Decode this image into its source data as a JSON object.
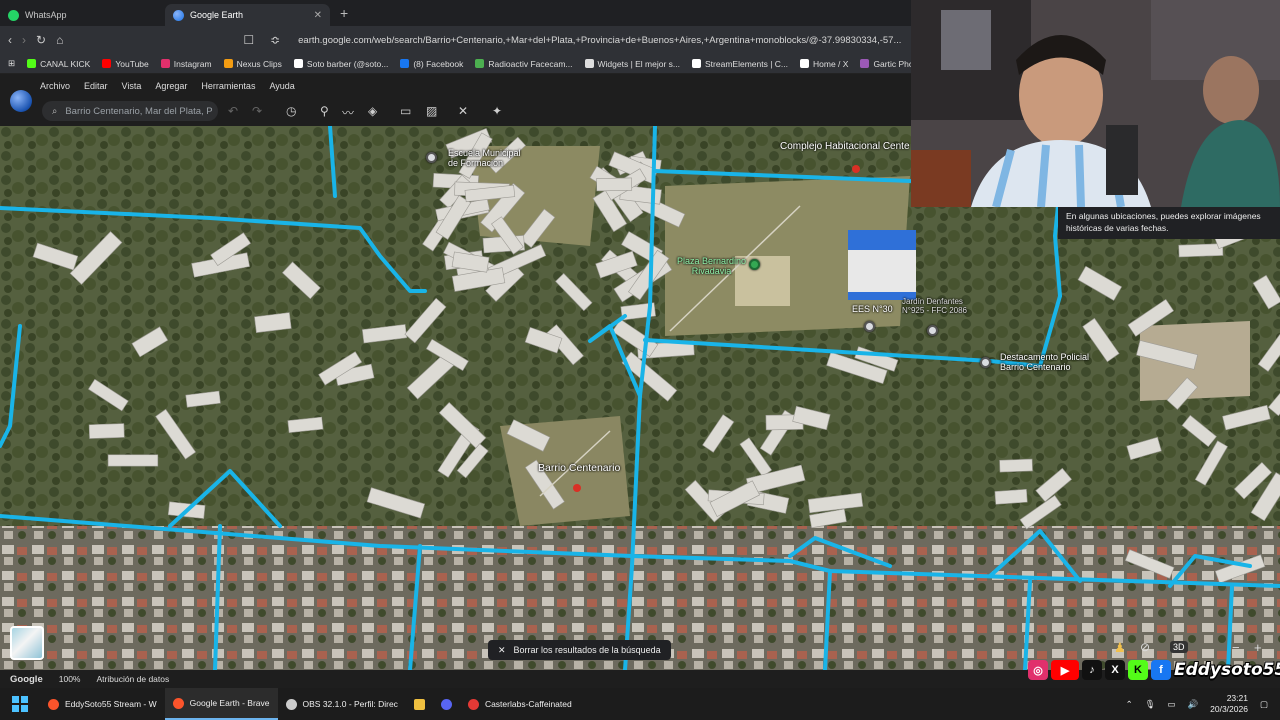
{
  "browser": {
    "tabs": [
      {
        "title": "WhatsApp",
        "active": false,
        "icon": "whatsapp-icon",
        "color": "#25d366"
      },
      {
        "title": "Google Earth",
        "active": true,
        "icon": "google-earth-icon",
        "color": "#4285f4"
      }
    ],
    "new_tab": "+",
    "url": "earth.google.com/web/search/Barrio+Centenario,+Mar+del+Plata,+Provincia+de+Buenos+Aires,+Argentina+monoblocks/@-37.99830334,-57...",
    "bookmarks": [
      {
        "label": "CANAL KICK",
        "color": "#53fc18"
      },
      {
        "label": "YouTube",
        "color": "#ff0000"
      },
      {
        "label": "Instagram",
        "color": "#e1306c"
      },
      {
        "label": "Nexus Clips",
        "color": "#f39c12"
      },
      {
        "label": "Soto barber (@soto...",
        "color": "#ffffff"
      },
      {
        "label": "(8) Facebook",
        "color": "#1877f2"
      },
      {
        "label": "Radioactiv Facecam...",
        "color": "#4caf50"
      },
      {
        "label": "Widgets | El mejor s...",
        "color": "#dddddd"
      },
      {
        "label": "StreamElements | C...",
        "color": "#ffffff"
      },
      {
        "label": "Home / X",
        "color": "#ffffff"
      },
      {
        "label": "Gartic Phone - Tele",
        "color": "#9b59b6"
      }
    ]
  },
  "earth": {
    "menu": [
      "Archivo",
      "Editar",
      "Vista",
      "Agregar",
      "Herramientas",
      "Ayuda"
    ],
    "search_value": "Barrio Centenario, Mar del Plata, P",
    "clear_results": "Borrar los resultados de la búsqueda",
    "status": {
      "logo": "Google",
      "zoom": "100%",
      "attribution": "Atribución de datos"
    },
    "tooltip": "En algunas ubicaciones, puedes explorar imágenes históricas de varias fechas.",
    "view_3d": "3D",
    "labels": [
      {
        "text": "Escuela Municipal de Formacion",
        "lines": [
          "Escuela Municipal",
          "de Formacion"
        ]
      },
      {
        "text": "Complejo Habitacional Cente",
        "lines": [
          "Complejo Habitacional Cente"
        ]
      },
      {
        "text": "Plaza Bernardino Rivadavia",
        "lines": [
          "Plaza Bernardino",
          "Rivadavia"
        ]
      },
      {
        "text": "EES N°30",
        "lines": [
          "EES N°30"
        ]
      },
      {
        "text": "Jardín Denfantes N°925 - FFC 2086",
        "lines": [
          "Jardín Denfantes",
          "N°925 - FFC 2086"
        ]
      },
      {
        "text": "Destacamento Policial Barrio Centenario",
        "lines": [
          "Destacamento Policial",
          "Barrio Centenario"
        ]
      },
      {
        "text": "Barrio Centenario",
        "lines": [
          "Barrio Centenario"
        ]
      }
    ]
  },
  "overlay": {
    "handle": "Eddysoto55",
    "socials": [
      {
        "name": "instagram-icon",
        "glyph": "◎",
        "color": "#e1306c"
      },
      {
        "name": "youtube-icon",
        "glyph": "▶",
        "color": "#ff0000"
      },
      {
        "name": "tiktok-icon",
        "glyph": "♪",
        "color": "#111111"
      },
      {
        "name": "x-icon",
        "glyph": "X",
        "color": "#111111"
      },
      {
        "name": "kick-icon",
        "glyph": "K",
        "color": "#53fc18"
      },
      {
        "name": "facebook-icon",
        "glyph": "f",
        "color": "#1877f2"
      }
    ]
  },
  "taskbar": {
    "items": [
      {
        "label": "EddySoto55 Stream - W",
        "color": "#fb542b",
        "active": false
      },
      {
        "label": "Google Earth - Brave",
        "color": "#fb542b",
        "active": true
      },
      {
        "label": "OBS 32.1.0 - Perfil: Direc",
        "color": "#cccccc",
        "active": false
      },
      {
        "label": "",
        "color": "#f0c040",
        "active": false
      },
      {
        "label": "",
        "color": "#5865f2",
        "active": false
      },
      {
        "label": "Casterlabs-Caffeinated",
        "color": "#e53935",
        "active": false
      }
    ],
    "time": "23:21",
    "date": "20/3/2026"
  }
}
